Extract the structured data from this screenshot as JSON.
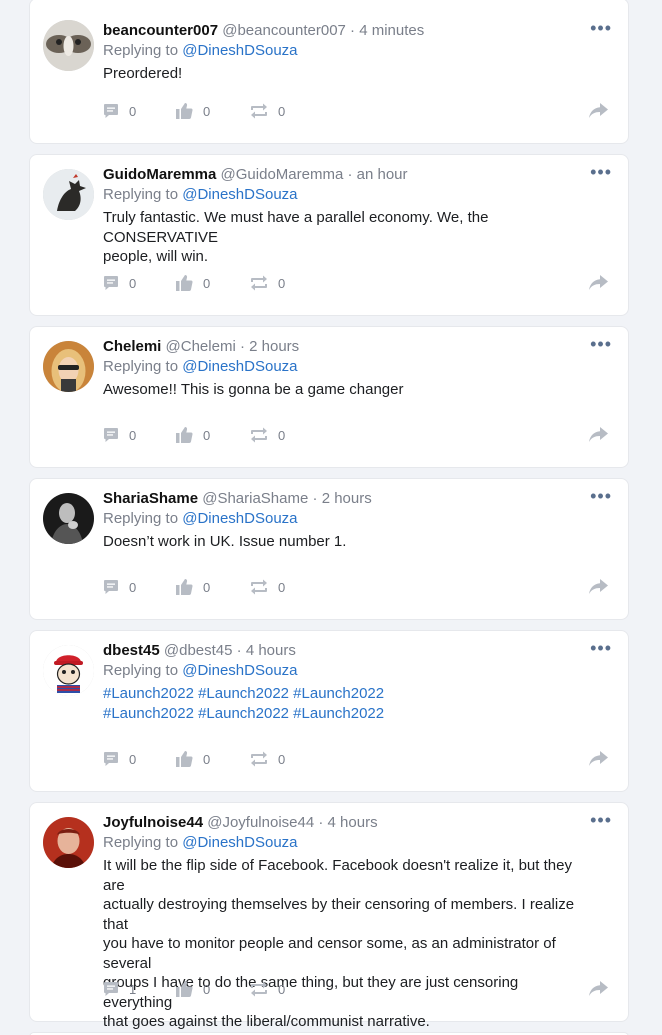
{
  "colors": {
    "link": "#2a73c8",
    "muted": "#7a7f8a",
    "icon": "#b7bcc4"
  },
  "posts": [
    {
      "author": "beancounter007",
      "handle": "@beancounter007",
      "sep": "·",
      "time": "4 minutes",
      "reply_prefix": "Replying to",
      "reply_to": "@DineshDSouza",
      "lines": [
        "Preordered!"
      ],
      "comments": "0",
      "likes": "0",
      "reposts": "0"
    },
    {
      "author": "GuidoMaremma",
      "handle": "@GuidoMaremma",
      "sep": "·",
      "time": "an hour",
      "reply_prefix": "Replying to",
      "reply_to": "@DineshDSouza",
      "lines": [
        "Truly fantastic. We must have a parallel economy. We, the CONSERVATIVE",
        "people, will win."
      ],
      "comments": "0",
      "likes": "0",
      "reposts": "0"
    },
    {
      "author": "Chelemi",
      "handle": "@Chelemi",
      "sep": "·",
      "time": "2 hours",
      "reply_prefix": "Replying to",
      "reply_to": "@DineshDSouza",
      "lines": [
        "Awesome!! This is gonna be a game changer"
      ],
      "comments": "0",
      "likes": "0",
      "reposts": "0"
    },
    {
      "author": "ShariaShame",
      "handle": "@ShariaShame",
      "sep": "·",
      "time": "2 hours",
      "reply_prefix": "Replying to",
      "reply_to": "@DineshDSouza",
      "lines": [
        "Doesn’t work in UK. Issue number 1."
      ],
      "comments": "0",
      "likes": "0",
      "reposts": "0"
    },
    {
      "author": "dbest45",
      "handle": "@dbest45",
      "sep": "·",
      "time": "4 hours",
      "reply_prefix": "Replying to",
      "reply_to": "@DineshDSouza",
      "lines": [
        "#Launch2022 #Launch2022 #Launch2022",
        "#Launch2022 #Launch2022 #Launch2022"
      ],
      "comments": "0",
      "likes": "0",
      "reposts": "0"
    },
    {
      "author": "Joyfulnoise44",
      "handle": "@Joyfulnoise44",
      "sep": "·",
      "time": "4 hours",
      "reply_prefix": "Replying to",
      "reply_to": "@DineshDSouza",
      "lines": [
        "It will be the flip side of Facebook. Facebook doesn't realize it, but they are",
        "actually destroying themselves by their censoring of members. I realize that",
        "you have to monitor people and censor some, as an administrator of several",
        "groups I have to do the same thing, but they are just censoring everything",
        "that goes against the liberal/communist narrative."
      ],
      "comments": "1",
      "likes": "0",
      "reposts": "0"
    }
  ]
}
